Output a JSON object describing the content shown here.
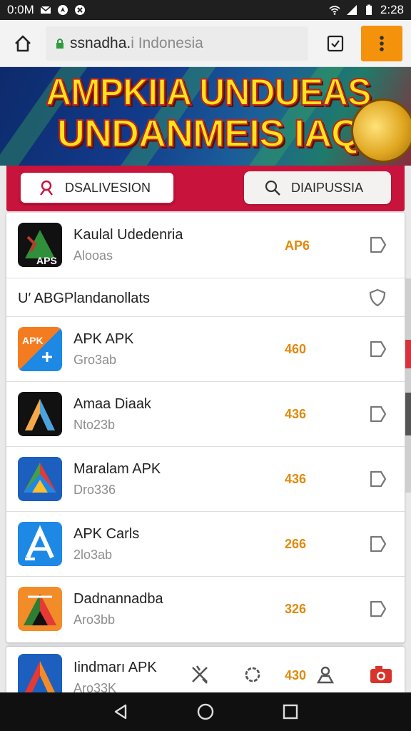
{
  "status_bar": {
    "time_left": "0:0M",
    "time_right": "2:28",
    "icons": [
      "mail-icon",
      "navigation-icon",
      "settings-icon",
      "wifi-icon",
      "signal-icon",
      "battery-icon"
    ]
  },
  "browser": {
    "url_main": "ssnadha.",
    "url_rest": "i Indonesia",
    "home_icon": "home-icon",
    "tab_icon": "tab-switcher-icon",
    "menu_icon": "menu-dots-icon",
    "accent": "#f5920b"
  },
  "banner": {
    "line1": "AMPKIIA UNDUEAS",
    "line2": "UNDANMEIS IAQ!"
  },
  "tabs": {
    "left_label": "DSALIVESION",
    "right_label": "DIAIPUSSIA",
    "accent": "#c8143c"
  },
  "list": {
    "items": [
      {
        "name": "Kaulal Udedenria",
        "sub": "Alooas",
        "value": "AP6",
        "icon": "app-icon-a-green"
      },
      {
        "section": "U′ ABGPlandanollats",
        "icon": "shield-icon"
      },
      {
        "name": "APK APK",
        "sub": "Gro3ab",
        "value": "460",
        "icon": "app-icon-apk-orange"
      },
      {
        "name": "Amaa Diaak",
        "sub": "Nto23b",
        "value": "436",
        "icon": "app-icon-a-black"
      },
      {
        "name": "Maralam APK",
        "sub": "Dro336",
        "value": "436",
        "icon": "app-icon-a-multicolor"
      },
      {
        "name": "APK Carls",
        "sub": "2lo3ab",
        "value": "266",
        "icon": "app-icon-a-blue"
      },
      {
        "name": "Dadnannadba",
        "sub": "Aro3bb",
        "value": "326",
        "icon": "app-icon-a-orange"
      }
    ],
    "bottom": {
      "name": "Iindmarı APK",
      "sub": "Aro33K",
      "value": "430"
    }
  },
  "toolbar_icons": [
    "tools-icon",
    "refresh-icon",
    "person-icon",
    "camera-icon"
  ],
  "nav_icons": [
    "back-icon",
    "home-circle-icon",
    "recents-icon"
  ]
}
